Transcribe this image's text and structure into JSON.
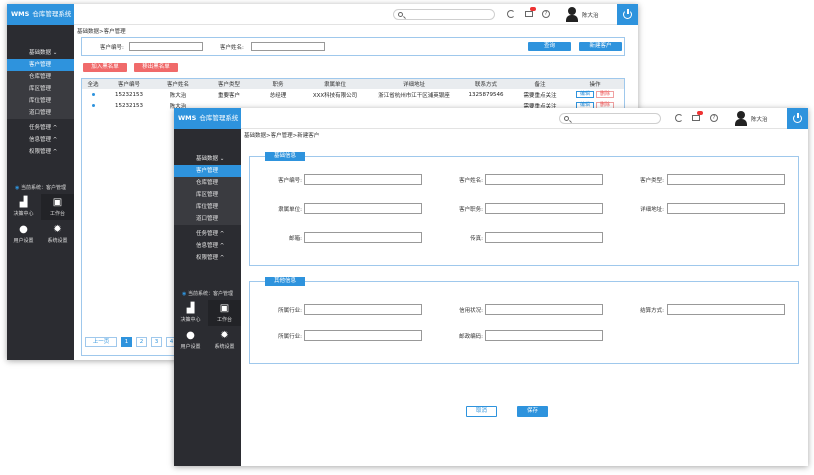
{
  "brand": {
    "prefix": "WMS",
    "name": "仓库管理系统",
    "collapse_glyph": "《"
  },
  "user": {
    "name": "陈大治"
  },
  "header": {
    "mail_count": ""
  },
  "sidebar": {
    "group_basic": "基础数据",
    "items_basic": [
      "客户管理",
      "仓库管理",
      "库区管理",
      "库位管理",
      "道口管理"
    ],
    "group_task": "任务管理",
    "group_info": "信息管理",
    "group_perm": "权限管理",
    "current_system": "当前系统：客户管理",
    "tiles": [
      "决策中心",
      "工作台",
      "用户设置",
      "系统设置"
    ]
  },
  "list_page": {
    "breadcrumb": "基础数据>客户管理",
    "filter_code_label": "客户编号:",
    "filter_name_label": "客户姓名:",
    "search_btn": "查询",
    "new_btn": "新建客户",
    "add_blacklist_btn": "加入黑名单",
    "remove_blacklist_btn": "移出黑名单",
    "columns": [
      "全选",
      "客户编号",
      "客户姓名",
      "客户类型",
      "职务",
      "隶属单位",
      "详细地址",
      "联系方式",
      "备注",
      "操作"
    ],
    "rows": [
      {
        "code": "15232153",
        "name": "陈大治",
        "type": "重要客户",
        "title": "总经理",
        "unit": "XXX科技有限公司",
        "address": "浙江省杭州市江干区浦英银座",
        "phone": "1325879546",
        "note": "需要重点关注"
      },
      {
        "code": "15232153",
        "name": "陈大治",
        "type": "",
        "title": "",
        "unit": "",
        "address": "",
        "phone": "",
        "note": "需要重点关注"
      }
    ],
    "edit_label": "编辑",
    "delete_label": "删除",
    "pager": {
      "prev": "上一页",
      "pages": [
        "1",
        "2",
        "3",
        "4"
      ]
    }
  },
  "form_page": {
    "breadcrumb": "基础数据>客户管理>新建客户",
    "basic_title": "基础信息",
    "basic_fields": [
      "客户编号:",
      "客户姓名:",
      "客户类型:",
      "隶属单位:",
      "客户职务:",
      "详细地址:",
      "邮箱:",
      "传真:"
    ],
    "other_title": "其他信息",
    "other_fields": [
      "所属行业:",
      "信用状况:",
      "结算方式:",
      "所属行业:",
      "邮政编码:"
    ],
    "cancel_btn": "取消",
    "save_btn": "保存"
  }
}
